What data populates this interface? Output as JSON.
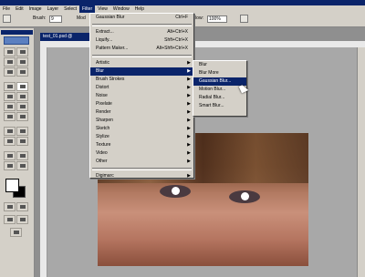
{
  "menubar": {
    "items": [
      {
        "label": "File"
      },
      {
        "label": "Edit"
      },
      {
        "label": "Image"
      },
      {
        "label": "Layer"
      },
      {
        "label": "Select"
      },
      {
        "label": "Filter"
      },
      {
        "label": "View"
      },
      {
        "label": "Window"
      },
      {
        "label": "Help"
      }
    ]
  },
  "options_bar": {
    "brush_label": "Brush:",
    "brush_size": "9",
    "mode_label": "Mod",
    "flow_label": "Flow:",
    "flow_value": "100%"
  },
  "document": {
    "tab_title": "test_01.psd @"
  },
  "filter_menu": {
    "last_filter": {
      "label": "Gaussian Blur",
      "shortcut": "Ctrl+F"
    },
    "extract": {
      "label": "Extract...",
      "shortcut": "Alt+Ctrl+X"
    },
    "liquify": {
      "label": "Liquify...",
      "shortcut": "Shft+Ctrl+X"
    },
    "pattern_maker": {
      "label": "Pattern Maker...",
      "shortcut": "Alt+Shft+Ctrl+X"
    },
    "submenus": [
      {
        "label": "Artistic"
      },
      {
        "label": "Blur"
      },
      {
        "label": "Brush Strokes"
      },
      {
        "label": "Distort"
      },
      {
        "label": "Noise"
      },
      {
        "label": "Pixelate"
      },
      {
        "label": "Render"
      },
      {
        "label": "Sharpen"
      },
      {
        "label": "Sketch"
      },
      {
        "label": "Stylize"
      },
      {
        "label": "Texture"
      },
      {
        "label": "Video"
      },
      {
        "label": "Other"
      }
    ],
    "digimarc": {
      "label": "Digimarc"
    }
  },
  "blur_menu": {
    "items": [
      {
        "label": "Blur"
      },
      {
        "label": "Blur More"
      },
      {
        "label": "Gaussian Blur..."
      },
      {
        "label": "Motion Blur..."
      },
      {
        "label": "Radial Blur..."
      },
      {
        "label": "Smart Blur..."
      }
    ]
  },
  "colors": {
    "highlight": "#0a246a",
    "menu_bg": "#d4d0c8"
  }
}
